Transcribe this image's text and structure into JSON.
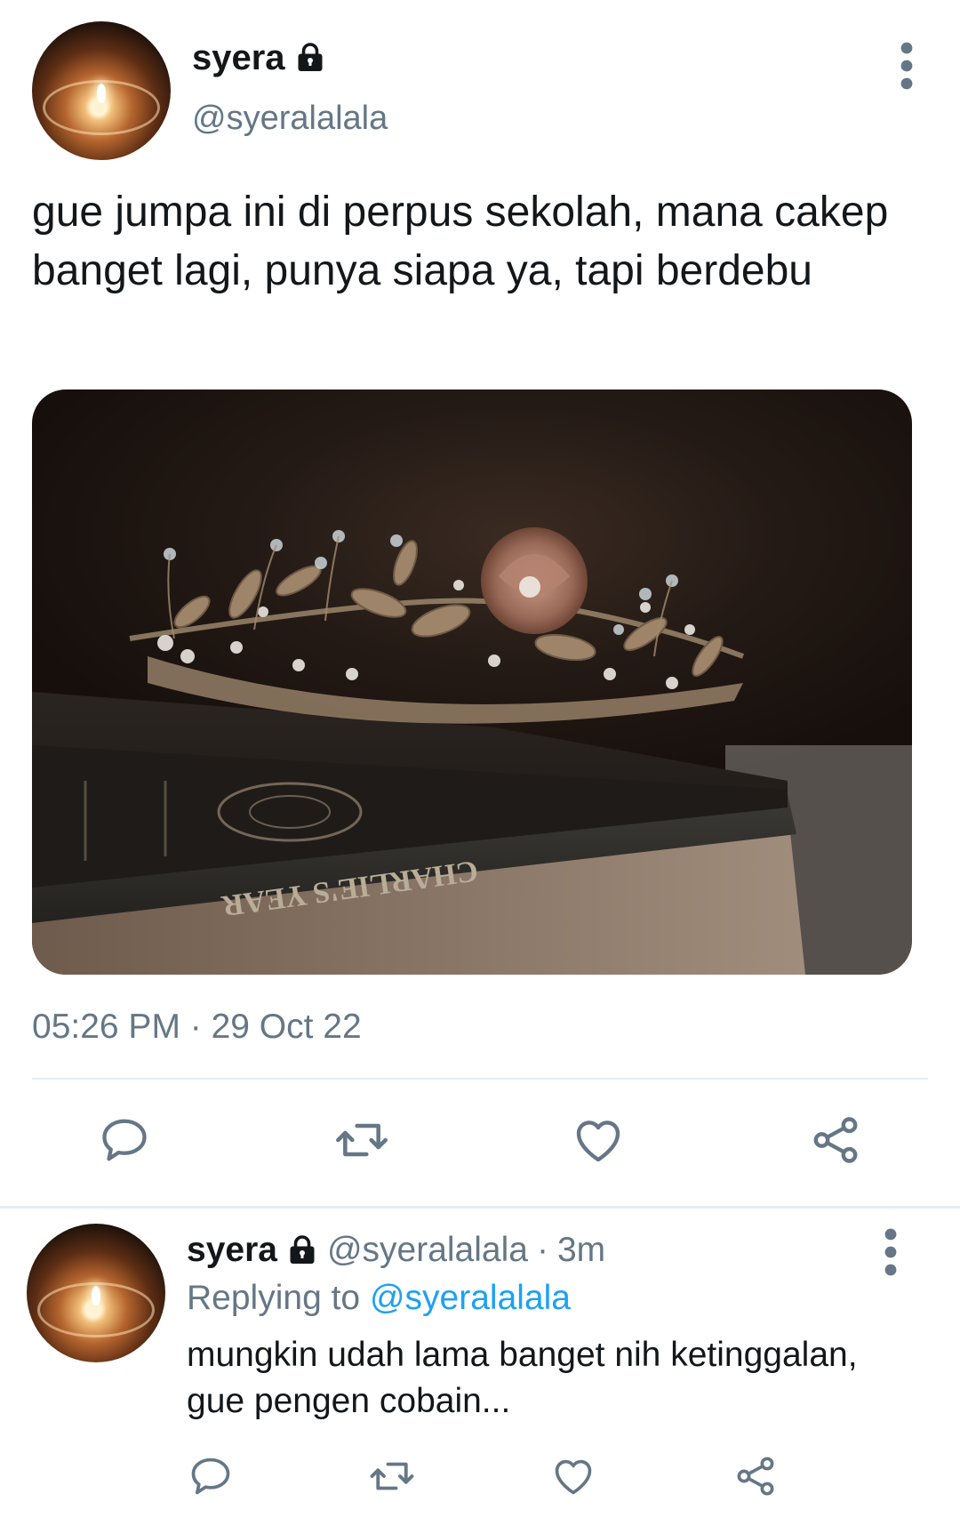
{
  "tweet": {
    "author": {
      "name": "syera",
      "handle": "@syeralalala",
      "protected_icon": "lock-icon",
      "avatar": "candle-avatar"
    },
    "text": "gue jumpa ini di perpus sekolah, mana cakep banget lagi, punya siapa ya, tapi berdebu",
    "media": {
      "subject": "photo",
      "book_spine_text": "CHARLIE'S YEAR"
    },
    "timestamp": "05:26 PM · 29 Oct 22",
    "actions": [
      {
        "name": "reply",
        "icon": "reply-icon"
      },
      {
        "name": "retweet",
        "icon": "retweet-icon"
      },
      {
        "name": "like",
        "icon": "heart-icon"
      },
      {
        "name": "share",
        "icon": "share-icon"
      }
    ]
  },
  "reply": {
    "author": {
      "name": "syera",
      "handle": "@syeralalala",
      "time": "3m",
      "separator": "·"
    },
    "replying_prefix": "Replying to",
    "replying_to": "@syeralalala",
    "text": "mungkin udah lama banget nih ketinggalan, gue pengen cobain...",
    "actions": [
      {
        "name": "reply",
        "icon": "reply-icon"
      },
      {
        "name": "retweet",
        "icon": "retweet-icon"
      },
      {
        "name": "like",
        "icon": "heart-icon"
      },
      {
        "name": "share",
        "icon": "share-icon"
      }
    ]
  },
  "colors": {
    "text": "#14171a",
    "secondary": "#657786",
    "accent": "#1da1f2",
    "divider": "#e6ecf0"
  }
}
